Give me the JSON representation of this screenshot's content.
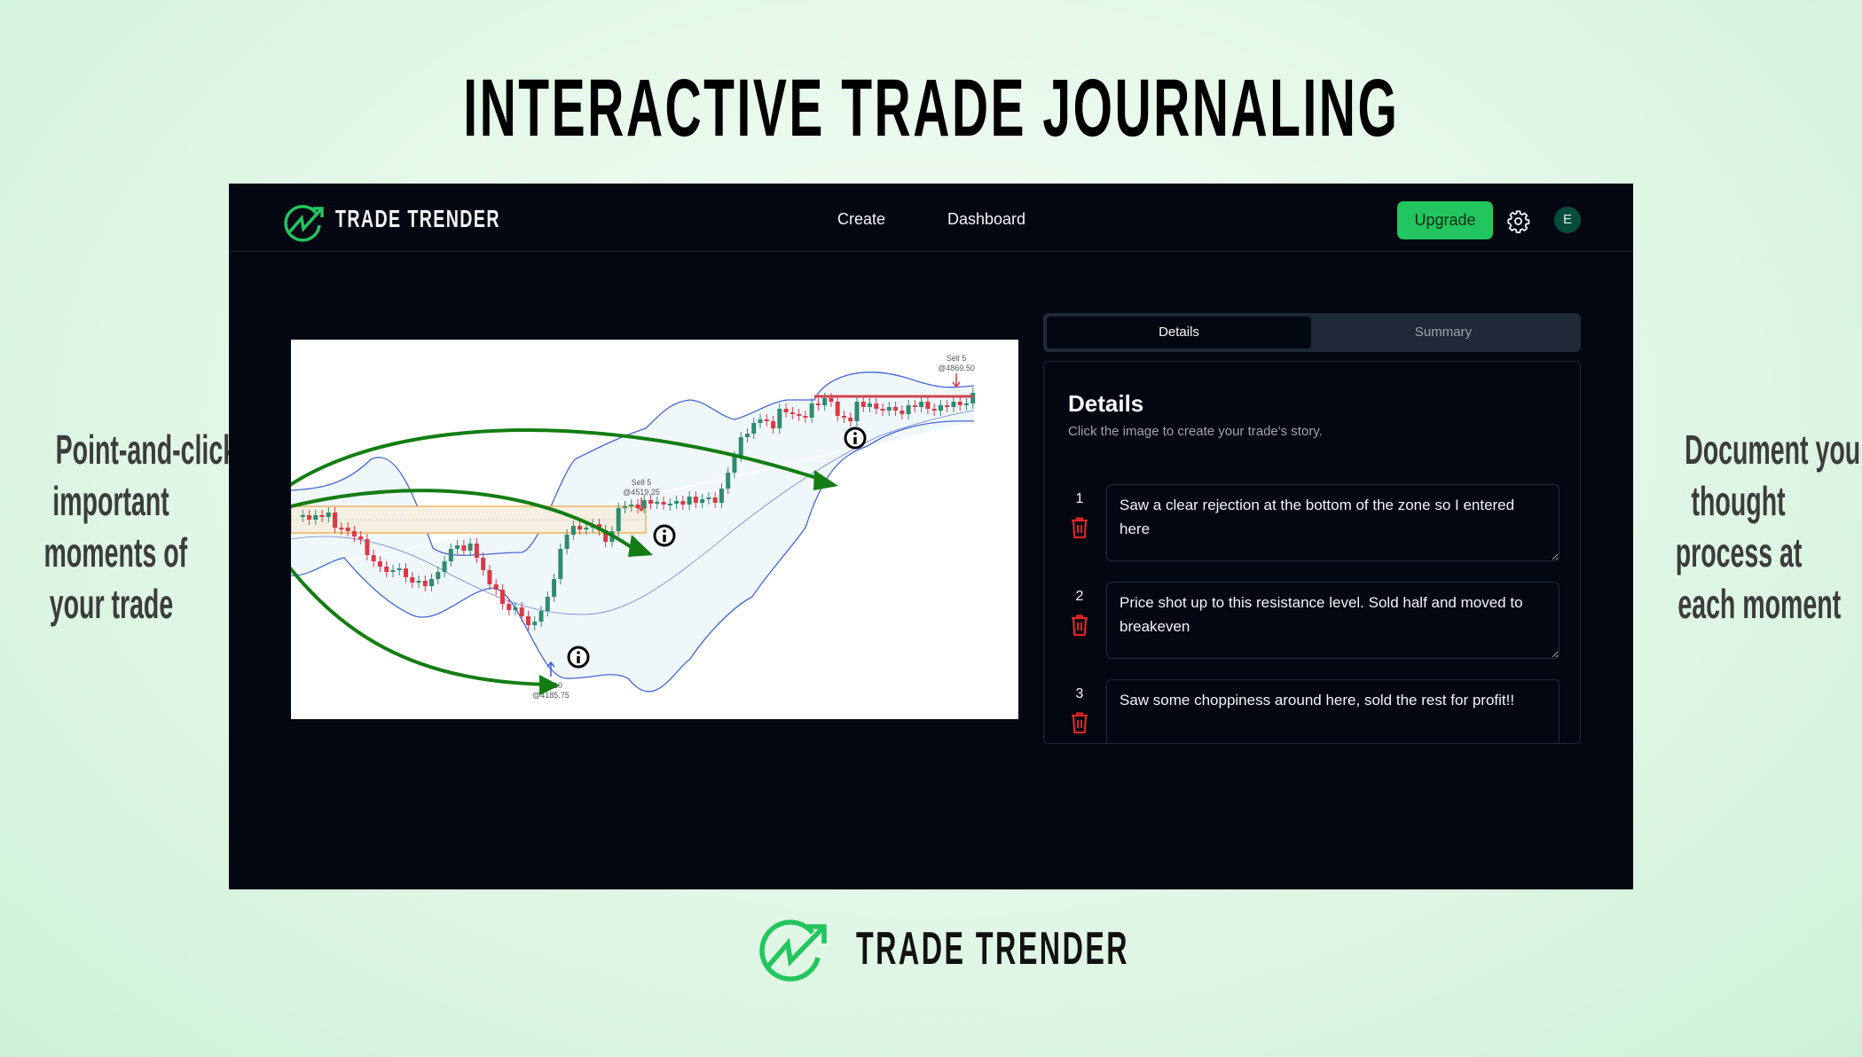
{
  "headline": "INTERACTIVE TRADE JOURNALING",
  "left_caption": [
    "Point-and-click",
    "important",
    "moments of",
    "your trade"
  ],
  "right_caption": [
    "Document your",
    "thought",
    "process at",
    "each moment"
  ],
  "app": {
    "brand": "TRADE TRENDER",
    "nav": {
      "create": "Create",
      "dashboard": "Dashboard"
    },
    "upgrade_label": "Upgrade",
    "avatar_initial": "E",
    "colors": {
      "accent": "#22c55e",
      "background": "#030712",
      "delete": "#dc2626",
      "annotation_arrow": "#137d13"
    }
  },
  "chart": {
    "markers": [
      {
        "label_line1": "B... 10",
        "label_line2": "@4185.75",
        "type": "buy"
      },
      {
        "label_line1": "Sell 5",
        "label_line2": "@4519.25",
        "type": "sell"
      },
      {
        "label_line1": "Sell 5",
        "label_line2": "@4869.50",
        "type": "sell"
      }
    ],
    "info_icons": 3
  },
  "panel": {
    "tabs": [
      {
        "label": "Details",
        "active": true
      },
      {
        "label": "Summary",
        "active": false
      }
    ],
    "title": "Details",
    "subtitle": "Click the image to create your trade's story.",
    "entries": [
      {
        "number": "1",
        "text": "Saw a clear rejection at the bottom of the zone so I entered here"
      },
      {
        "number": "2",
        "text": "Price shot up to this resistance level. Sold half and moved to breakeven"
      },
      {
        "number": "3",
        "text": "Saw some choppiness around here, sold the rest for profit!!"
      }
    ]
  },
  "footer_brand": "TRADE TRENDER"
}
